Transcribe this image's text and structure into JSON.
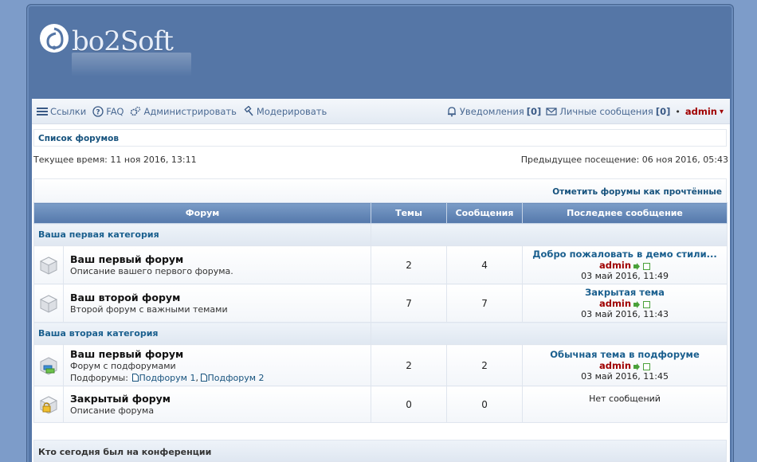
{
  "logo": {
    "text": "bo2Soft"
  },
  "navbar": {
    "links": "Ссылки",
    "faq": "FAQ",
    "admin": "Администрировать",
    "moderate": "Модерировать",
    "notifications": "Уведомления",
    "notifications_count": "[0]",
    "messages": "Личные сообщения",
    "messages_count": "[0]",
    "separator": "•",
    "username": "admin",
    "username_arrow": "▾"
  },
  "breadcrumb": "Список форумов",
  "time": {
    "current": "Текущее время: 11 ноя 2016, 13:11",
    "last_visit": "Предыдущее посещение: 06 ноя 2016, 05:43"
  },
  "mark_read": "Отметить форумы как прочтённые",
  "table": {
    "headers": [
      "Форум",
      "Темы",
      "Сообщения",
      "Последнее сообщение"
    ],
    "categories": [
      {
        "name": "Ваша первая категория",
        "forums": [
          {
            "title": "Ваш первый форум",
            "desc": "Описание вашего первого форума.",
            "topics": "2",
            "posts": "4",
            "last_title": "Добро пожаловать в демо стили...",
            "last_author": "admin",
            "last_date": "03 май 2016, 11:49",
            "icon": "forum-read-icon"
          },
          {
            "title": "Ваш второй форум",
            "desc": "Второй форум с важными темами",
            "topics": "7",
            "posts": "7",
            "last_title": "Закрытая тема",
            "last_author": "admin",
            "last_date": "03 май 2016, 11:43",
            "icon": "forum-read-icon"
          }
        ]
      },
      {
        "name": "Ваша вторая категория",
        "forums": [
          {
            "title": "Ваш первый форум",
            "desc": "Форум с подфорумами",
            "subforums_label": "Подфорумы:",
            "subforums": [
              "Подфорум 1",
              "Подфорум 2"
            ],
            "subforum_sep": ",",
            "topics": "2",
            "posts": "2",
            "last_title": "Обычная тема в подфоруме",
            "last_author": "admin",
            "last_date": "03 май 2016, 11:45",
            "icon": "forum-subforums-icon"
          },
          {
            "title": "Закрытый форум",
            "desc": "Описание форума",
            "topics": "0",
            "posts": "0",
            "no_posts": "Нет сообщений",
            "icon": "forum-locked-icon"
          }
        ]
      }
    ]
  },
  "who_is_online": "Кто сегодня был на конференции",
  "colors": {
    "background": "#7d9cc9",
    "header": "#5576a6",
    "link": "#16527d",
    "username": "#a00000"
  }
}
